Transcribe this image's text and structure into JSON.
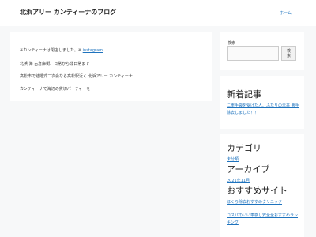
{
  "header": {
    "site_title": "北浜アリー カンティーナのブログ",
    "nav_home": "ホーム"
  },
  "main": {
    "line1_prefix": "※カンティーナは閉店しました。※ ",
    "line1_link": "instagram",
    "line2": "北浜 海 古倉庫街、日常から非日常まで",
    "line3": "高松市で結婚式二次会なら高松駅近く 北浜アリー カンティーナ",
    "line4": "カンティーナで海辺の貸切パーティーを"
  },
  "search": {
    "label": "検索",
    "button_line1": "検",
    "button_line2": "索"
  },
  "recent": {
    "heading": "新着記事",
    "item": "二重手袋を受けた人、ふたりの未来 悪手除去しました！！"
  },
  "category": {
    "heading": "カテゴリ",
    "item": "未分類"
  },
  "archive": {
    "heading": "アーカイブ",
    "item": "2021年11月"
  },
  "recommend": {
    "heading": "おすすめサイト",
    "item1": "ほくろ除去おすすめクリニック",
    "item2": "コスパのいい車検し安全全おすすめランキング"
  }
}
